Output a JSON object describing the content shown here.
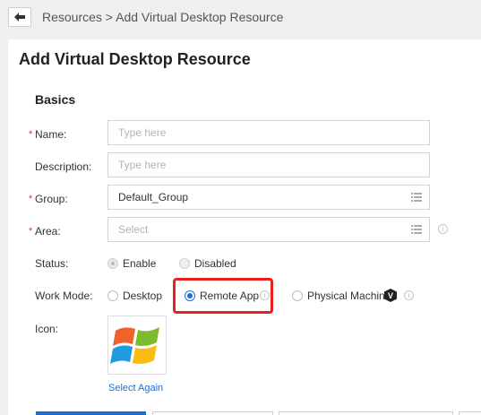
{
  "breadcrumb": "Resources > Add Virtual Desktop Resource",
  "page_title": "Add Virtual Desktop Resource",
  "section_title": "Basics",
  "form": {
    "name": {
      "label": "Name:",
      "placeholder": "Type here",
      "required": true
    },
    "description": {
      "label": "Description:",
      "placeholder": "Type here",
      "required": false
    },
    "group": {
      "label": "Group:",
      "value": "Default_Group",
      "required": true
    },
    "area": {
      "label": "Area:",
      "placeholder": "Select",
      "required": true
    },
    "status": {
      "label": "Status:",
      "options": [
        "Enable",
        "Disabled"
      ],
      "selected": "Enable"
    },
    "work_mode": {
      "label": "Work Mode:",
      "options": [
        "Desktop",
        "Remote App",
        "Physical Machine"
      ],
      "selected": "Remote App"
    },
    "icon": {
      "label": "Icon:",
      "action": "Select Again"
    }
  },
  "required_marker": "*",
  "info_glyph": "i",
  "vip_badge": "V",
  "colors": {
    "accent": "#1a6fd6",
    "highlight": "#e8211f",
    "required": "#e0322f"
  }
}
